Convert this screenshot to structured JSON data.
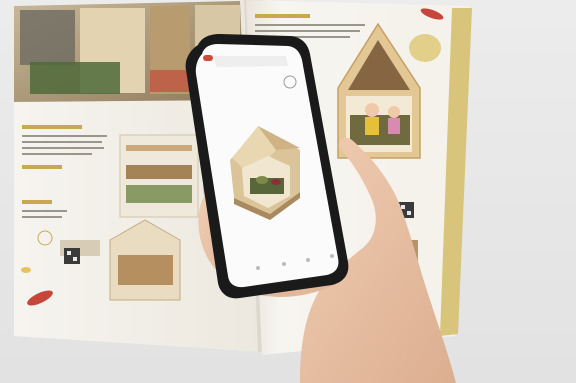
{
  "scene": {
    "description_visible_text": [],
    "colors": {
      "background": "#e9e9ea",
      "page": "#f7f4ee",
      "accent_mustard": "#d8c47a",
      "wood": "#d9bb8a",
      "phone_frame": "#1a1a1a",
      "skin": "#e9c2a6"
    },
    "icons": {
      "phone_share": "share-icon",
      "phone_cube": "ar-cube-icon"
    }
  }
}
